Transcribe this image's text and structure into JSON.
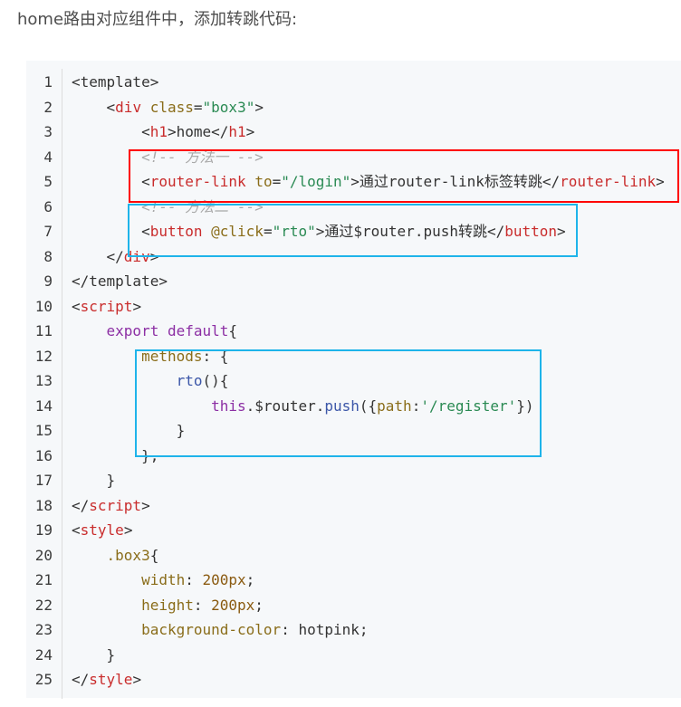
{
  "intro": "home路由对应组件中，添加转跳代码:",
  "lines": [
    [
      {
        "t": "<template>",
        "c": ""
      }
    ],
    [
      {
        "t": "    <",
        "c": ""
      },
      {
        "t": "div",
        "c": "tag"
      },
      {
        "t": " ",
        "c": ""
      },
      {
        "t": "class",
        "c": "attr"
      },
      {
        "t": "=",
        "c": ""
      },
      {
        "t": "\"box3\"",
        "c": "str"
      },
      {
        "t": ">",
        "c": ""
      }
    ],
    [
      {
        "t": "        <",
        "c": ""
      },
      {
        "t": "h1",
        "c": "tag"
      },
      {
        "t": ">home</",
        "c": ""
      },
      {
        "t": "h1",
        "c": "tag"
      },
      {
        "t": ">",
        "c": ""
      }
    ],
    [
      {
        "t": "        <!-- 方法一 -->",
        "c": "comment"
      }
    ],
    [
      {
        "t": "        <",
        "c": ""
      },
      {
        "t": "router-link",
        "c": "tag"
      },
      {
        "t": " ",
        "c": ""
      },
      {
        "t": "to",
        "c": "attr"
      },
      {
        "t": "=",
        "c": ""
      },
      {
        "t": "\"/login\"",
        "c": "str"
      },
      {
        "t": ">通过router-link标签转跳</",
        "c": ""
      },
      {
        "t": "router-link",
        "c": "tag"
      },
      {
        "t": ">",
        "c": ""
      }
    ],
    [
      {
        "t": "        <!-- 方法二 -->",
        "c": "comment"
      }
    ],
    [
      {
        "t": "        <",
        "c": ""
      },
      {
        "t": "button",
        "c": "tag"
      },
      {
        "t": " ",
        "c": ""
      },
      {
        "t": "@click",
        "c": "attr"
      },
      {
        "t": "=",
        "c": ""
      },
      {
        "t": "\"rto\"",
        "c": "str"
      },
      {
        "t": ">通过$router.push转跳</",
        "c": ""
      },
      {
        "t": "button",
        "c": "tag"
      },
      {
        "t": ">",
        "c": ""
      }
    ],
    [
      {
        "t": "    </",
        "c": ""
      },
      {
        "t": "div",
        "c": "tag"
      },
      {
        "t": ">",
        "c": ""
      }
    ],
    [
      {
        "t": "</template>",
        "c": ""
      }
    ],
    [
      {
        "t": "<",
        "c": ""
      },
      {
        "t": "script",
        "c": "tag"
      },
      {
        "t": ">",
        "c": ""
      }
    ],
    [
      {
        "t": "    ",
        "c": ""
      },
      {
        "t": "export",
        "c": "kw"
      },
      {
        "t": " ",
        "c": ""
      },
      {
        "t": "default",
        "c": "kw"
      },
      {
        "t": "{",
        "c": ""
      }
    ],
    [
      {
        "t": "        ",
        "c": ""
      },
      {
        "t": "methods",
        "c": "attr"
      },
      {
        "t": ": {",
        "c": ""
      }
    ],
    [
      {
        "t": "            ",
        "c": ""
      },
      {
        "t": "rto",
        "c": "fn"
      },
      {
        "t": "(){",
        "c": ""
      }
    ],
    [
      {
        "t": "                ",
        "c": ""
      },
      {
        "t": "this",
        "c": "kw"
      },
      {
        "t": ".$router.",
        "c": ""
      },
      {
        "t": "push",
        "c": "fn"
      },
      {
        "t": "({",
        "c": ""
      },
      {
        "t": "path",
        "c": "attr"
      },
      {
        "t": ":",
        "c": ""
      },
      {
        "t": "'/register'",
        "c": "str"
      },
      {
        "t": "})",
        "c": ""
      }
    ],
    [
      {
        "t": "            }",
        "c": ""
      }
    ],
    [
      {
        "t": "        },",
        "c": ""
      }
    ],
    [
      {
        "t": "    }",
        "c": ""
      }
    ],
    [
      {
        "t": "</",
        "c": ""
      },
      {
        "t": "script",
        "c": "tag"
      },
      {
        "t": ">",
        "c": ""
      }
    ],
    [
      {
        "t": "<",
        "c": ""
      },
      {
        "t": "style",
        "c": "tag"
      },
      {
        "t": ">",
        "c": ""
      }
    ],
    [
      {
        "t": "    ",
        "c": ""
      },
      {
        "t": ".box3",
        "c": "attr"
      },
      {
        "t": "{",
        "c": ""
      }
    ],
    [
      {
        "t": "        ",
        "c": ""
      },
      {
        "t": "width",
        "c": "attr"
      },
      {
        "t": ": ",
        "c": ""
      },
      {
        "t": "200px",
        "c": "num"
      },
      {
        "t": ";",
        "c": ""
      }
    ],
    [
      {
        "t": "        ",
        "c": ""
      },
      {
        "t": "height",
        "c": "attr"
      },
      {
        "t": ": ",
        "c": ""
      },
      {
        "t": "200px",
        "c": "num"
      },
      {
        "t": ";",
        "c": ""
      }
    ],
    [
      {
        "t": "        ",
        "c": ""
      },
      {
        "t": "background-color",
        "c": "attr"
      },
      {
        "t": ": hotpink;",
        "c": ""
      }
    ],
    [
      {
        "t": "    }",
        "c": ""
      }
    ],
    [
      {
        "t": "</",
        "c": ""
      },
      {
        "t": "style",
        "c": "tag"
      },
      {
        "t": ">",
        "c": ""
      }
    ]
  ],
  "highlight_colors": {
    "red": "#ff0000",
    "blue": "#1eb4ea"
  }
}
